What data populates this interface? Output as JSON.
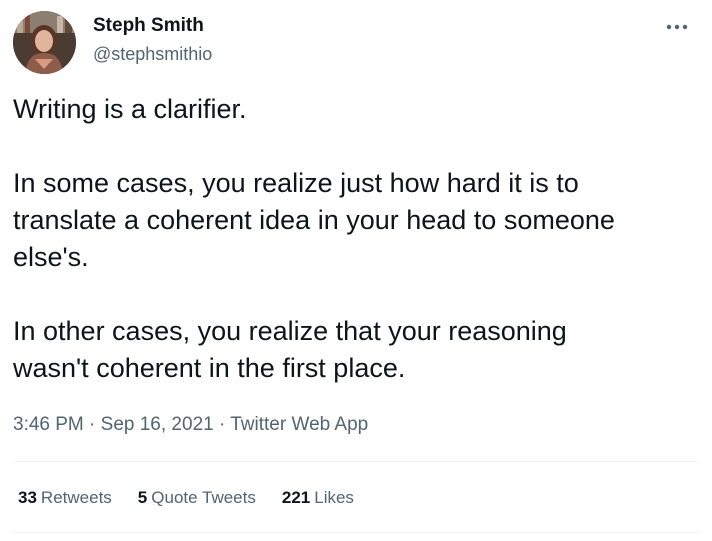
{
  "author": {
    "display_name": "Steph Smith",
    "handle": "@stephsmithio"
  },
  "tweet": {
    "text": "Writing is a clarifier.\n\nIn some cases, you realize just how hard it is to\ntranslate a coherent idea in your head to someone\nelse's.\n\nIn other cases, you realize that your reasoning\nwasn't coherent in the first place."
  },
  "meta": {
    "time": "3:46 PM",
    "separator": "·",
    "date": "Sep 16, 2021",
    "source": "Twitter Web App"
  },
  "stats": {
    "retweets_count": "33",
    "retweets_label": "Retweets",
    "quote_tweets_count": "5",
    "quote_tweets_label": "Quote Tweets",
    "likes_count": "221",
    "likes_label": "Likes"
  },
  "icons": {
    "more": "more-horizontal-icon",
    "avatar": "profile-photo"
  },
  "colors": {
    "text_primary": "#0f1419",
    "text_secondary": "#536471",
    "divider": "#eff3f4"
  }
}
